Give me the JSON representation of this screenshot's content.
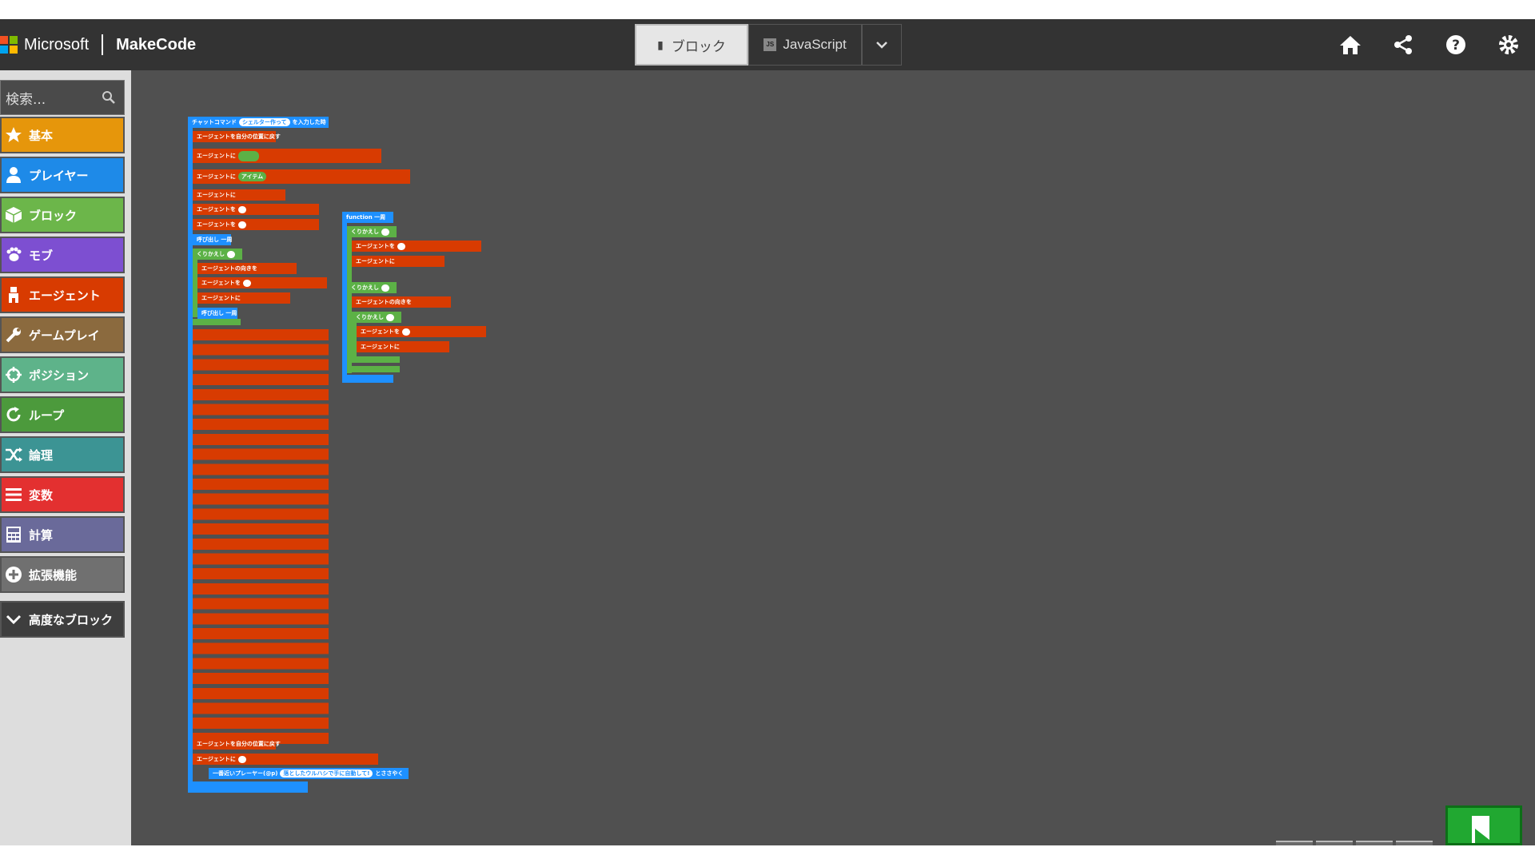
{
  "header": {
    "ms_label": "Microsoft",
    "app_label": "MakeCode",
    "tabs": {
      "blocks": "ブロック",
      "javascript": "JavaScript"
    },
    "icons": [
      "home-icon",
      "share-icon",
      "help-icon",
      "settings-icon"
    ]
  },
  "toolbox": {
    "search_placeholder": "検索...",
    "categories": [
      {
        "label": "基本",
        "color": "#e6960b",
        "icon": "star-icon"
      },
      {
        "label": "プレイヤー",
        "color": "#1e8ae8",
        "icon": "person-icon"
      },
      {
        "label": "ブロック",
        "color": "#6cb64a",
        "icon": "cube-icon"
      },
      {
        "label": "モブ",
        "color": "#7d4fd1",
        "icon": "paw-icon"
      },
      {
        "label": "エージェント",
        "color": "#d83b01",
        "icon": "agent-icon"
      },
      {
        "label": "ゲームプレイ",
        "color": "#8b6a3e",
        "icon": "wrench-icon"
      },
      {
        "label": "ポジション",
        "color": "#5eb38a",
        "icon": "crosshair-icon"
      },
      {
        "label": "ループ",
        "color": "#4c9a3c",
        "icon": "loop-icon"
      },
      {
        "label": "論理",
        "color": "#3c9494",
        "icon": "shuffle-icon"
      },
      {
        "label": "変数",
        "color": "#e33030",
        "icon": "list-icon"
      },
      {
        "label": "計算",
        "color": "#6a6a9a",
        "icon": "calculator-icon"
      },
      {
        "label": "拡張機能",
        "color": "#707070",
        "icon": "plus-circle-icon"
      },
      {
        "label": "高度なブロック",
        "color": "#3e3e3e",
        "icon": "chevron-down-icon"
      }
    ]
  },
  "blocks": {
    "chat_command": "チャットコマンド",
    "chat_arg": "シェルター作って",
    "chat_suffix": "を入力した時",
    "teleport": "エージェントを自分の位置に戻す",
    "set_item": "エージェントに",
    "item_label": "アイテム",
    "move": "エージェントを",
    "turn": "エージェントに",
    "dir": "エージェントの向きを",
    "call": "呼び出し 一周",
    "repeat": "くりかえし",
    "function": "function 一周",
    "say_target": "一番近いプレーヤー(@p)",
    "say_text": "落としたウルハシで手に自動して!",
    "say_suffix": "とささやく"
  },
  "colors": {
    "menubar": "#333333",
    "workspace": "#505050",
    "run": "#21a831"
  }
}
